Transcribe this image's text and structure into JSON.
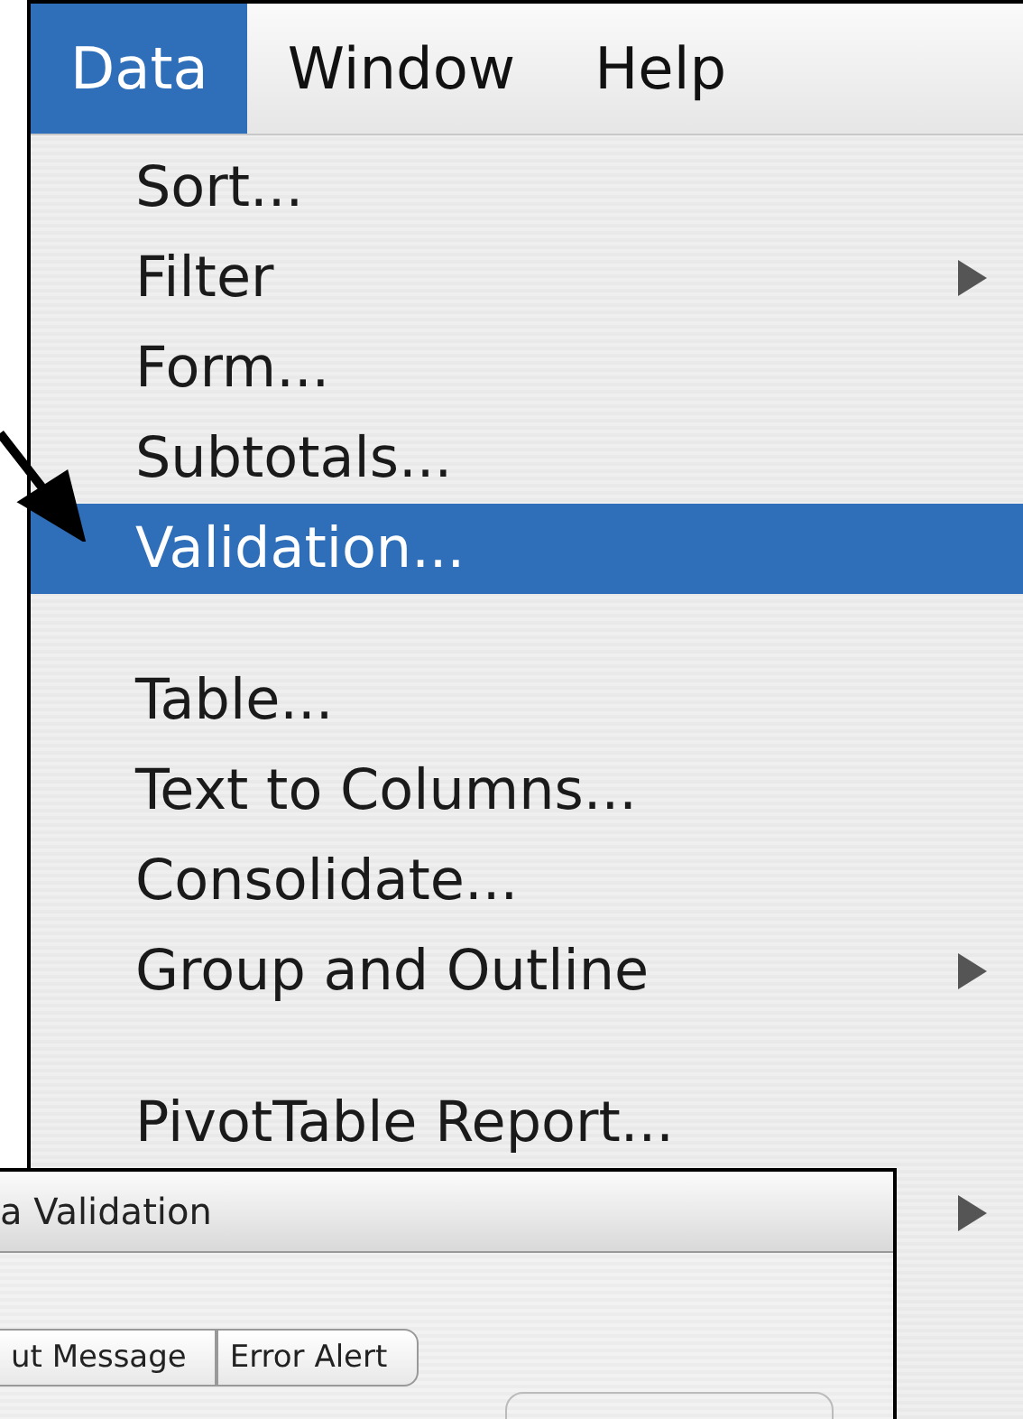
{
  "menu_bar": [
    {
      "label": "Data",
      "selected": true
    },
    {
      "label": "Window",
      "selected": false
    },
    {
      "label": "Help",
      "selected": false
    }
  ],
  "menu_items": [
    {
      "kind": "item",
      "label": "Sort...",
      "submenu": false,
      "selected": false
    },
    {
      "kind": "item",
      "label": "Filter",
      "submenu": true,
      "selected": false
    },
    {
      "kind": "item",
      "label": "Form...",
      "submenu": false,
      "selected": false
    },
    {
      "kind": "item",
      "label": "Subtotals...",
      "submenu": false,
      "selected": false
    },
    {
      "kind": "item",
      "label": "Validation...",
      "submenu": false,
      "selected": true
    },
    {
      "kind": "separator"
    },
    {
      "kind": "item",
      "label": "Table...",
      "submenu": false,
      "selected": false
    },
    {
      "kind": "item",
      "label": "Text to Columns...",
      "submenu": false,
      "selected": false
    },
    {
      "kind": "item",
      "label": "Consolidate...",
      "submenu": false,
      "selected": false
    },
    {
      "kind": "item",
      "label": "Group and Outline",
      "submenu": true,
      "selected": false
    },
    {
      "kind": "separator"
    },
    {
      "kind": "item",
      "label": "PivotTable Report...",
      "submenu": false,
      "selected": false
    },
    {
      "kind": "item",
      "submenu": true,
      "selected": false
    }
  ],
  "dialog": {
    "title": "a Validation",
    "tabs": [
      {
        "label": "ut Message"
      },
      {
        "label": "Error Alert"
      }
    ]
  }
}
